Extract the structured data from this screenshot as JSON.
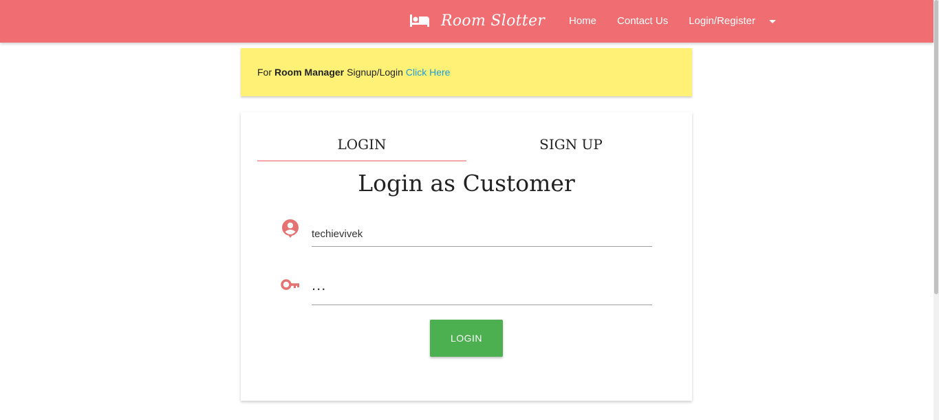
{
  "header": {
    "brand_name": "Room Slotter",
    "brand_icon": "bed-icon",
    "nav": {
      "home": "Home",
      "contact": "Contact Us",
      "login_register": "Login/Register"
    },
    "colors": {
      "background": "#f06d72",
      "text": "#ffffff"
    }
  },
  "notice": {
    "prefix": "For",
    "emphasis": "Room Manager",
    "middle": "Signup/Login",
    "link": "Click Here",
    "colors": {
      "background": "#fff176",
      "link": "#1e9bd7"
    }
  },
  "auth_card": {
    "tabs": {
      "login": "LOGIN",
      "signup": "SIGN UP",
      "active": "login"
    },
    "title": "Login as Customer",
    "username": {
      "icon": "account-circle-icon",
      "value": "techievivek"
    },
    "password": {
      "icon": "key-icon",
      "masked_value": "..."
    },
    "submit_label": "LOGIN",
    "colors": {
      "submit": "#4caf50",
      "tab_indicator": "#f6a5a8",
      "icon": "#e57373"
    }
  }
}
